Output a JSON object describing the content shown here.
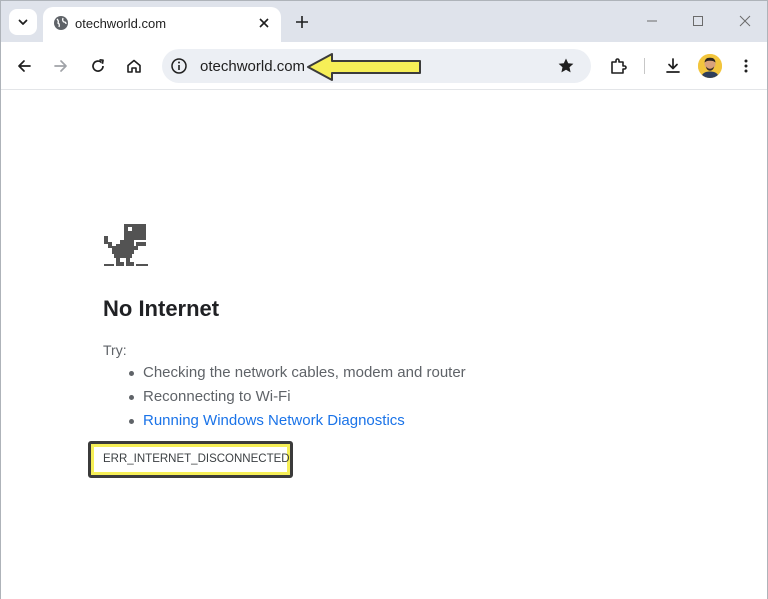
{
  "browser": {
    "tab": {
      "title": "otechworld.com",
      "icon": "globe-icon"
    },
    "new_tab_label": "+",
    "window_controls": [
      "minimize-icon",
      "maximize-icon",
      "close-icon"
    ]
  },
  "toolbar": {
    "url": "otechworld.com",
    "icons": [
      "back-arrow-icon",
      "forward-arrow-icon",
      "reload-icon",
      "home-icon",
      "info-icon",
      "star-icon",
      "extensions-icon",
      "download-icon",
      "avatar",
      "more-vert-icon"
    ]
  },
  "error_page": {
    "title": "No Internet",
    "try_label": "Try:",
    "suggestions": [
      "Checking the network cables, modem and router",
      "Reconnecting to Wi-Fi"
    ],
    "link": "Running Windows Network Diagnostics",
    "error_code": "ERR_INTERNET_DISCONNECTED",
    "icon": "dino-icon"
  },
  "colors": {
    "tabstrip": "#dfe3eb",
    "omnibox": "#eceff4",
    "link": "#1a73e8",
    "highlight": "#f6ef57",
    "text_secondary": "#5f6368"
  }
}
